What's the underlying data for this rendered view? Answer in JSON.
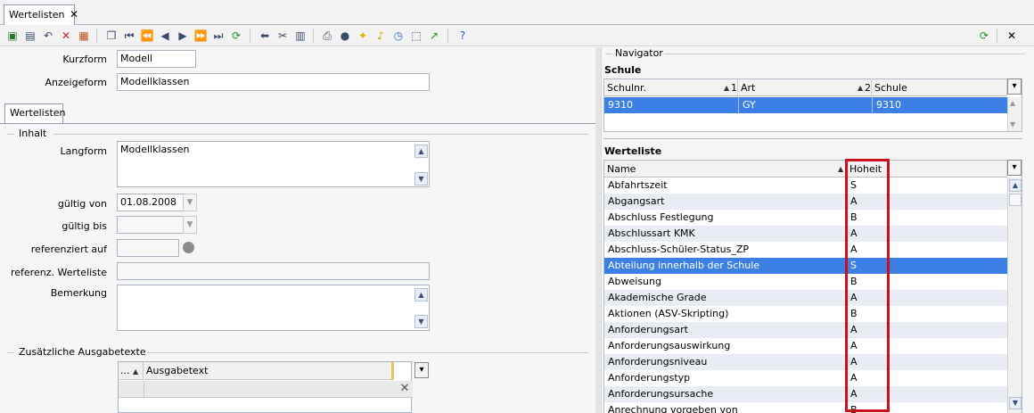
{
  "tab": {
    "title": "Wertelisten",
    "close": "✕"
  },
  "toolbar": {
    "left_icons": [
      "new-icon",
      "save-icon",
      "undo-icon",
      "delete-icon",
      "edit-icon",
      "copy-icon",
      "first-icon",
      "prev-page-icon",
      "prev-icon",
      "next-icon",
      "next-page-icon",
      "last-icon",
      "refresh-icon",
      "back-icon",
      "cut-icon",
      "paste-icon",
      "print-icon",
      "view-icon",
      "bulb-icon",
      "bell-icon",
      "clock-icon",
      "select-icon",
      "chart-icon",
      "help-icon"
    ],
    "right_close": "✕"
  },
  "form": {
    "kurzform_label": "Kurzform",
    "kurzform_value": "Modell",
    "anzeigeform_label": "Anzeigeform",
    "anzeigeform_value": "Modellklassen",
    "inner_tab": "Wertelisten",
    "inhalt_group": "Inhalt",
    "langform_label": "Langform",
    "langform_value": "Modellklassen",
    "gueltig_von_label": "gültig von",
    "gueltig_von_value": "01.08.2008",
    "gueltig_bis_label": "gültig bis",
    "gueltig_bis_value": "",
    "referenziert_auf_label": "referenziert auf",
    "referenziert_auf_value": "",
    "referenz_werteliste_label": "referenz. Werteliste",
    "referenz_werteliste_value": "",
    "bemerkung_label": "Bemerkung",
    "bemerkung_value": "",
    "ausgabetexte_group": "Zusätzliche Ausgabetexte",
    "ag_col1": "...",
    "ag_col2": "Ausgabetext"
  },
  "navigator": {
    "title": "Navigator",
    "schule": {
      "title": "Schule",
      "columns": [
        {
          "label": "Schulnr.",
          "sort": "1"
        },
        {
          "label": "Art",
          "sort": "2"
        },
        {
          "label": "Schule"
        }
      ],
      "rows": [
        [
          "9310",
          "GY",
          "9310"
        ]
      ]
    },
    "werteliste": {
      "title": "Werteliste",
      "columns": [
        "Name",
        "Hoheit"
      ],
      "rows": [
        [
          "Abfahrtszeit",
          "S"
        ],
        [
          "Abgangsart",
          "A"
        ],
        [
          "Abschluss Festlegung",
          "B"
        ],
        [
          "Abschlussart KMK",
          "A"
        ],
        [
          "Abschluss-Schüler-Status_ZP",
          "A"
        ],
        [
          "Abteilung innerhalb der Schule",
          "S"
        ],
        [
          "Abweisung",
          "B"
        ],
        [
          "Akademische Grade",
          "A"
        ],
        [
          "Aktionen (ASV-Skripting)",
          "B"
        ],
        [
          "Anforderungsart",
          "A"
        ],
        [
          "Anforderungsauswirkung",
          "A"
        ],
        [
          "Anforderungsniveau",
          "A"
        ],
        [
          "Anforderungstyp",
          "A"
        ],
        [
          "Anforderungsursache",
          "A"
        ],
        [
          "Anrechnung vorgeben von",
          "B"
        ]
      ],
      "selected_index": 5
    }
  }
}
